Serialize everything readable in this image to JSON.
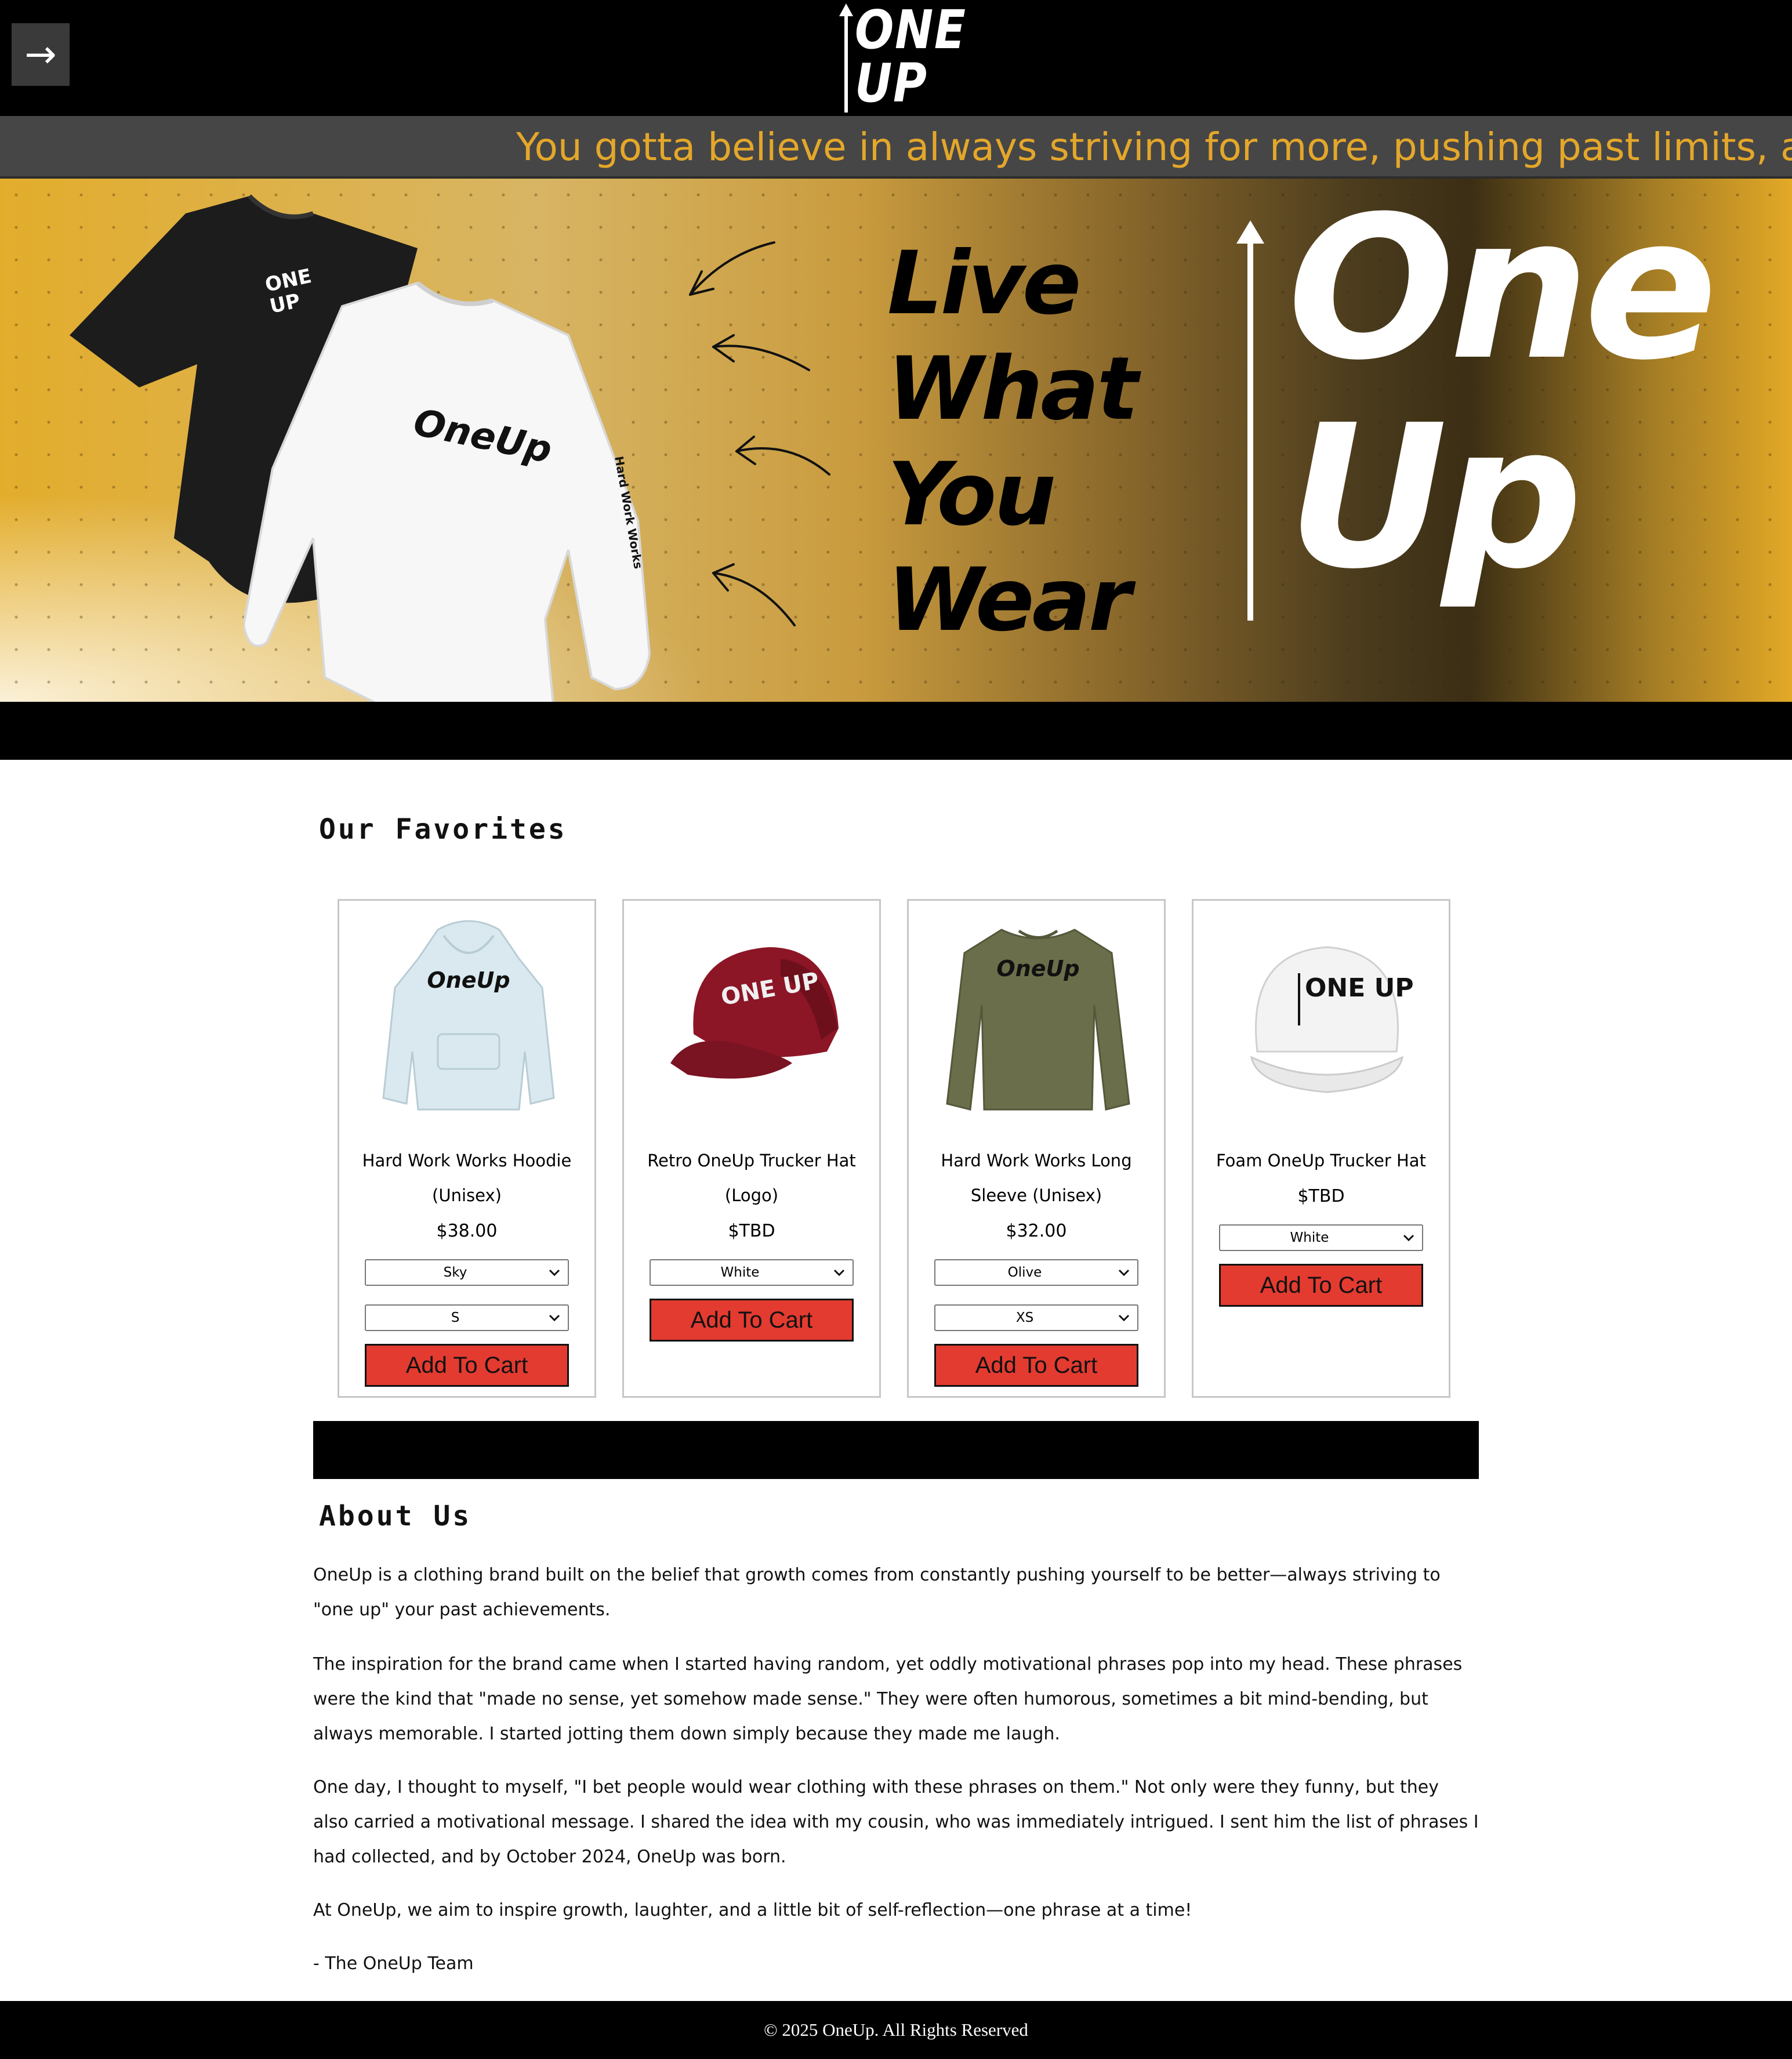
{
  "header": {
    "menu_icon": "arrow-right-icon",
    "menu_glyph": "→",
    "logo_lines": [
      "ONE",
      "UP"
    ]
  },
  "marquee": {
    "text": "You gotta believe in always striving for more, pushing past limits, and n"
  },
  "hero": {
    "slogan": [
      "Live",
      "What",
      "You",
      "Wear"
    ],
    "brand": [
      "One",
      "Up"
    ],
    "shirt_black_print": [
      "ONE",
      "UP"
    ],
    "shirt_white_print": "OneUp",
    "sleeve_print": "Hard Work Works"
  },
  "favorites": {
    "title": "Our Favorites",
    "add_to_cart_label": "Add To Cart",
    "products": [
      {
        "name_lines": [
          "Hard Work Works Hoodie",
          "(Unisex)"
        ],
        "price": "$38.00",
        "print": "OneUp",
        "selects": [
          "Sky",
          "S"
        ],
        "color": "#d9e9ef"
      },
      {
        "name_lines": [
          "Retro OneUp Trucker Hat",
          "(Logo)"
        ],
        "price": "$TBD",
        "print": "ONE UP",
        "selects": [
          "White"
        ],
        "color": "#8c1626"
      },
      {
        "name_lines": [
          "Hard Work Works Long",
          "Sleeve (Unisex)"
        ],
        "price": "$32.00",
        "print": "OneUp",
        "selects": [
          "Olive",
          "XS"
        ],
        "color": "#6b6e4a"
      },
      {
        "name_lines": [
          "Foam OneUp Trucker Hat"
        ],
        "price": "$TBD",
        "print": "ONE UP",
        "selects": [
          "White"
        ],
        "color": "#f3f3f3"
      }
    ]
  },
  "about": {
    "title": "About Us",
    "paragraphs": [
      "OneUp is a clothing brand built on the belief that growth comes from constantly pushing yourself to be better—always striving to \"one up\" your past achievements.",
      "The inspiration for the brand came when I started having random, yet oddly motivational phrases pop into my head. These phrases were the kind that \"made no sense, yet somehow made sense.\" They were often humorous, sometimes a bit mind-bending, but always memorable. I started jotting them down simply because they made me laugh.",
      "One day, I thought to myself, \"I bet people would wear clothing with these phrases on them.\" Not only were they funny, but they also carried a motivational message. I shared the idea with my cousin, who was immediately intrigued. I sent him the list of phrases I had collected, and by October 2024, OneUp was born.",
      "At OneUp, we aim to inspire growth, laughter, and a little bit of self-reflection—one phrase at a time!",
      "- The OneUp Team"
    ]
  },
  "footer": {
    "text": "© 2025 OneUp. All Rights Reserved"
  },
  "colors": {
    "accent_gold": "#e4a72a",
    "cart_red": "#e33b30",
    "marquee_bg": "#464646"
  }
}
